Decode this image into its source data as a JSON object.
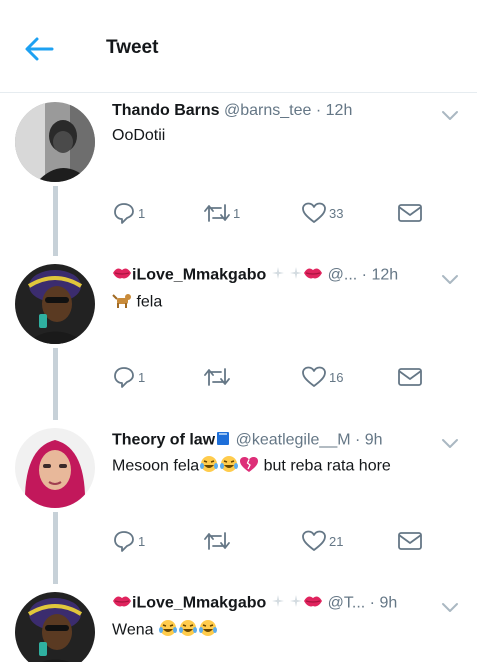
{
  "header": {
    "title": "Tweet"
  },
  "tweets": [
    {
      "name": "Thando Barns",
      "handle": "@barns_tee",
      "time": "12h",
      "text": "OoDotii",
      "replies": "1",
      "retweets": "1",
      "likes": "33"
    },
    {
      "name": "iLove_Mmakgabo",
      "handle": "@...",
      "time": "12h",
      "text": "fela",
      "replies": "1",
      "retweets": "",
      "likes": "16"
    },
    {
      "name": "Theory of law",
      "handle": "@keatlegile__M",
      "time": "9h",
      "text": "Mesoon fela",
      "text2": "but reba rata hore",
      "replies": "1",
      "retweets": "",
      "likes": "21"
    },
    {
      "name": "iLove_Mmakgabo",
      "handle": "@T...",
      "time": "9h",
      "text": "Wena"
    }
  ],
  "separator": "·",
  "icons": {
    "back": "back-arrow-icon",
    "more": "chevron-down-icon",
    "reply": "reply-icon",
    "retweet": "retweet-icon",
    "like": "heart-icon",
    "message": "envelope-icon"
  },
  "colors": {
    "accent": "#1da1f2",
    "muted": "#657786",
    "thread": "#c7d1d8"
  }
}
